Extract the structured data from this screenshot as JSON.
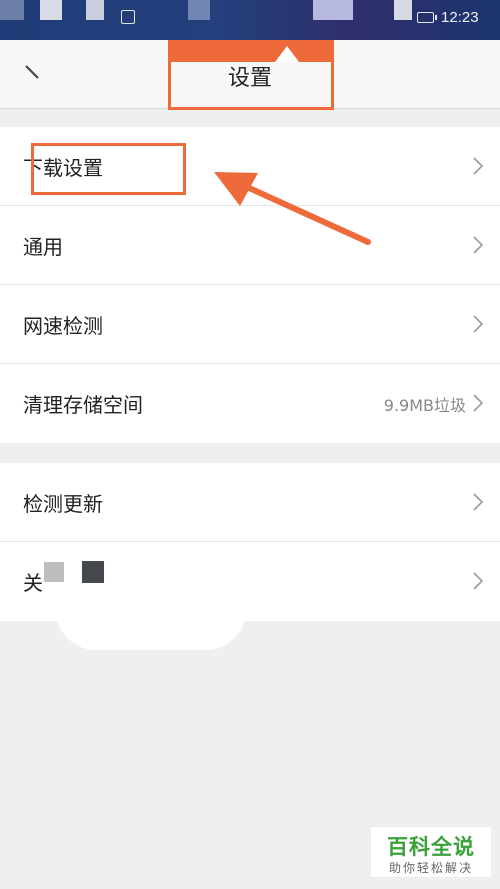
{
  "status_bar": {
    "time": "12:23"
  },
  "header": {
    "title": "设置",
    "back_icon": "back-arrow-icon"
  },
  "sections": [
    [
      {
        "label": "下载设置",
        "detail": ""
      },
      {
        "label": "通用",
        "detail": ""
      },
      {
        "label": "网速检测",
        "detail": ""
      },
      {
        "label": "清理存储空间",
        "detail": "9.9MB垃圾"
      }
    ],
    [
      {
        "label": "检测更新",
        "detail": ""
      },
      {
        "label": "关",
        "detail": ""
      }
    ]
  ],
  "annotation": {
    "highlight_color": "#ef6a3b"
  },
  "watermark": {
    "line1": "百科全说",
    "line2": "助你轻松解决"
  }
}
